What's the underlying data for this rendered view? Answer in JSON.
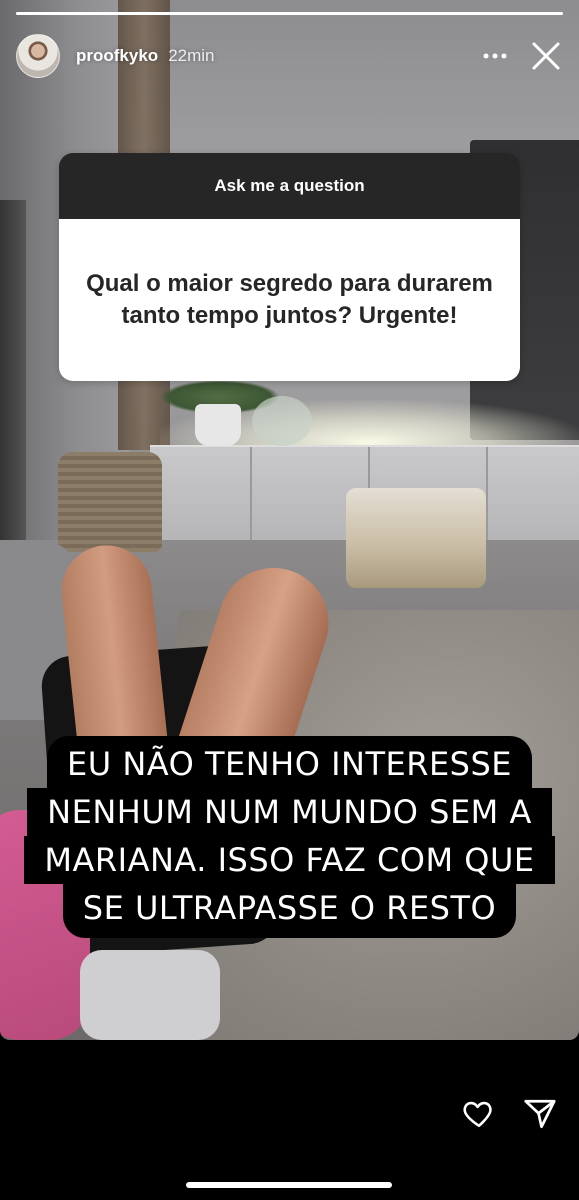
{
  "story": {
    "progress": 1.0,
    "username": "proofkyko",
    "timestamp": "22min"
  },
  "icons": {
    "more": "more-horizontal-icon",
    "close": "close-icon",
    "heart": "heart-icon",
    "send": "send-icon"
  },
  "question_sticker": {
    "header": "Ask me a question",
    "question": "Qual o maior segredo para durarem tanto tempo juntos? Urgente!"
  },
  "answer": {
    "lines": [
      "EU NÃO TENHO INTERESSE",
      "NENHUM NUM MUNDO SEM A",
      "MARIANA. ISSO FAZ COM QUE",
      "SE ULTRAPASSE O RESTO"
    ]
  },
  "colors": {
    "sticker_header_bg": "#262626",
    "sticker_body_bg": "#ffffff",
    "caption_bg": "#000000",
    "caption_text": "#ffffff"
  }
}
